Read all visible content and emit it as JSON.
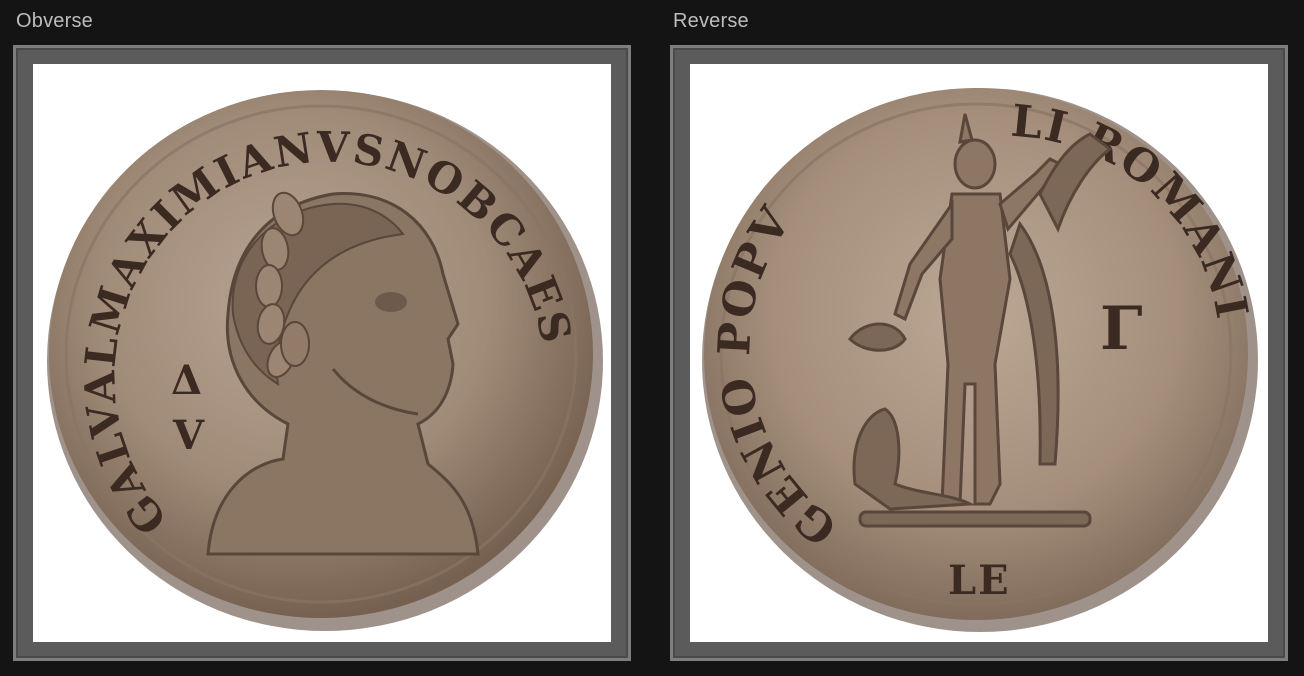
{
  "panels": [
    {
      "id": "obverse",
      "label": "Obverse",
      "legend": "GALVALMAXIMIANVSNOBCAES",
      "field_marks": [
        "Δ",
        "V"
      ]
    },
    {
      "id": "reverse",
      "label": "Reverse",
      "legend_left": "GENIO POPV",
      "legend_right": "LI ROMANI",
      "field_mark": "Γ",
      "exergue": "LE"
    }
  ],
  "colors": {
    "page_background": "#141414",
    "frame": "#5b5b5b",
    "coin_metal": "#a08a78",
    "coin_shadow": "#6e5a4c",
    "coin_text": "#3b2a22"
  }
}
